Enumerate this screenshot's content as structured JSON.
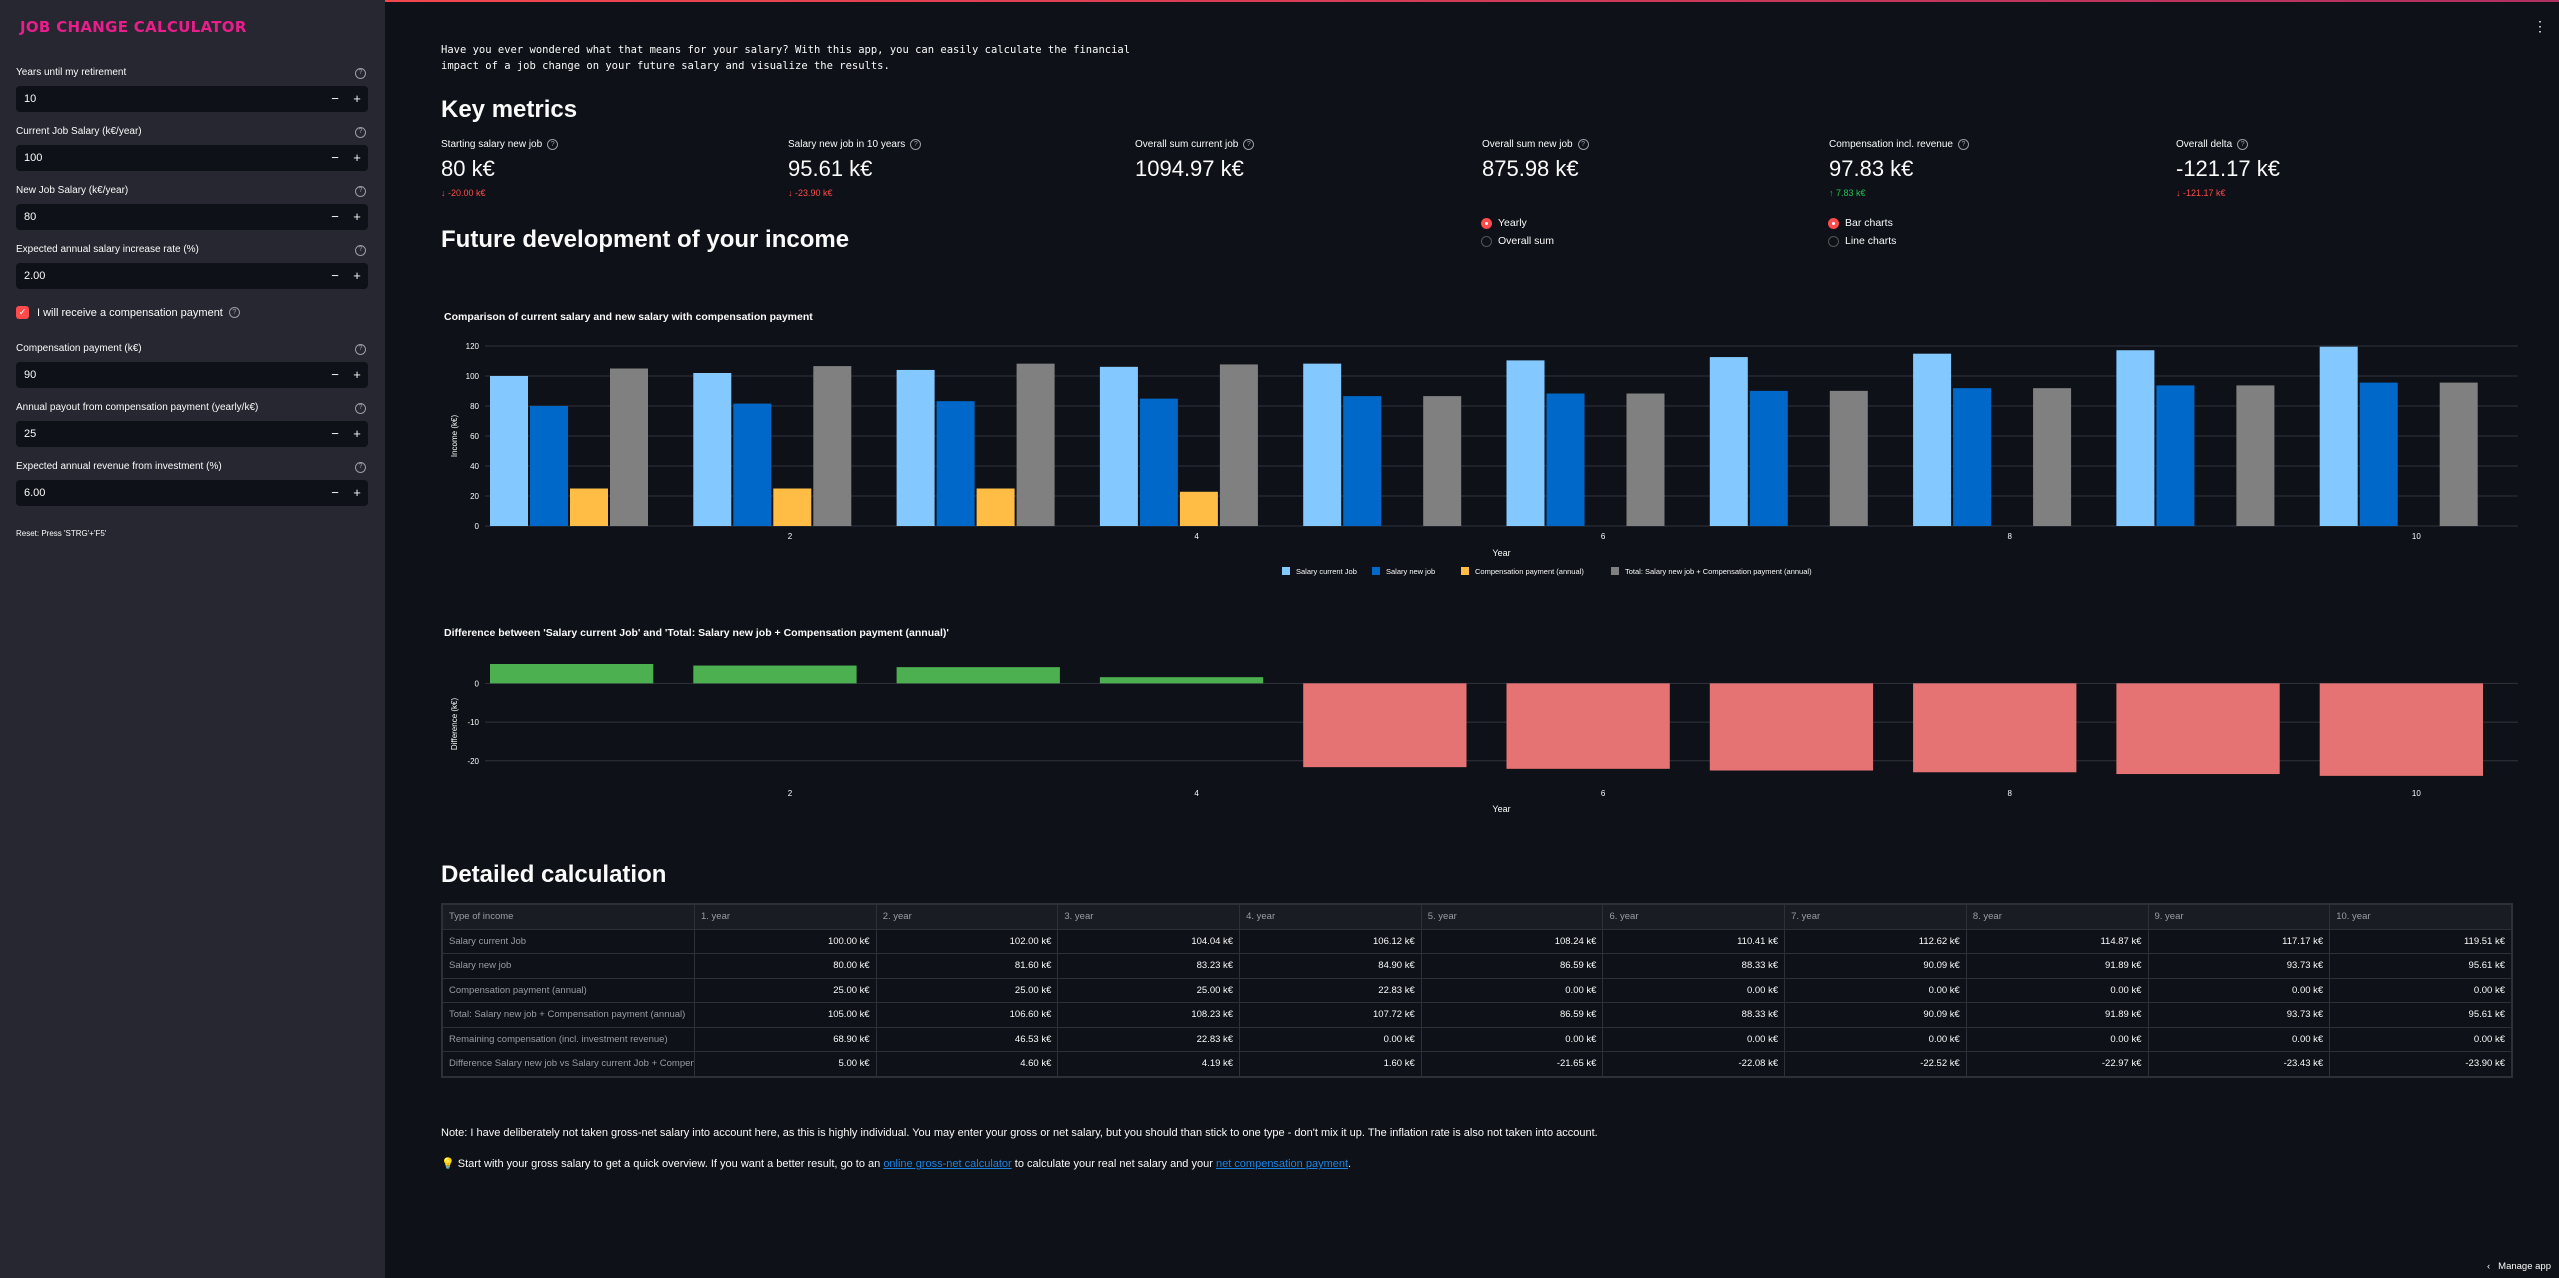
{
  "sidebar": {
    "title": "JOB CHANGE CALCULATOR",
    "fields": [
      {
        "label": "Years until my retirement",
        "value": "10"
      },
      {
        "label": "Current Job Salary (k€/year)",
        "value": "100"
      },
      {
        "label": "New Job Salary (k€/year)",
        "value": "80"
      },
      {
        "label": "Expected annual salary increase rate (%)",
        "value": "2.00"
      }
    ],
    "checkbox_label": "I will receive a compensation payment",
    "fields2": [
      {
        "label": "Compensation payment (k€)",
        "value": "90"
      },
      {
        "label": "Annual payout from compensation payment (yearly/k€)",
        "value": "25"
      },
      {
        "label": "Expected annual revenue from investment (%)",
        "value": "6.00"
      }
    ],
    "minus": "−",
    "plus": "+",
    "help": "?",
    "reset_hint": "Reset: Press 'STRG'+'F5'"
  },
  "intro": "Have you ever wondered what that means for your salary? With this app, you can easily calculate the financial impact of a job change on your future salary and visualize the results.",
  "key_metrics": {
    "heading": "Key metrics",
    "items": [
      {
        "label": "Starting salary new job",
        "value": "80 k€",
        "delta": "-20.00 k€",
        "dir": "down"
      },
      {
        "label": "Salary new job in 10 years",
        "value": "95.61 k€",
        "delta": "-23.90 k€",
        "dir": "down"
      },
      {
        "label": "Overall sum current job",
        "value": "1094.97 k€",
        "delta": "",
        "dir": ""
      },
      {
        "label": "Overall sum new job",
        "value": "875.98 k€",
        "delta": "",
        "dir": ""
      },
      {
        "label": "Compensation incl. revenue",
        "value": "97.83 k€",
        "delta": "7.83 k€",
        "dir": "up"
      },
      {
        "label": "Overall delta",
        "value": "-121.17 k€",
        "delta": "-121.17 k€",
        "dir": "down"
      }
    ]
  },
  "future": {
    "heading": "Future development of your income",
    "radio_period": [
      "Yearly",
      "Overall sum"
    ],
    "radio_period_selected": "Yearly",
    "radio_chart": [
      "Bar charts",
      "Line charts"
    ],
    "radio_chart_selected": "Bar charts"
  },
  "chart_data": [
    {
      "type": "bar",
      "title": "Comparison of current salary and new salary with compensation payment",
      "xlabel": "Year",
      "ylabel": "Income (k€)",
      "ylim": [
        0,
        120
      ],
      "yticks": [
        0,
        20,
        40,
        60,
        80,
        100,
        120
      ],
      "x": [
        1,
        2,
        3,
        4,
        5,
        6,
        7,
        8,
        9,
        10
      ],
      "xticks": [
        2,
        4,
        6,
        8,
        10
      ],
      "grid": true,
      "legend_position": "bottom",
      "series": [
        {
          "name": "Salary current Job",
          "color": "#83c9ff",
          "values": [
            100.0,
            102.0,
            104.04,
            106.12,
            108.24,
            110.41,
            112.62,
            114.87,
            117.17,
            119.51
          ]
        },
        {
          "name": "Salary new job",
          "color": "#0068c9",
          "values": [
            80.0,
            81.6,
            83.23,
            84.9,
            86.59,
            88.33,
            90.09,
            91.89,
            93.73,
            95.61
          ]
        },
        {
          "name": "Compensation payment (annual)",
          "color": "#ffabab",
          "values": [
            25.0,
            25.0,
            25.0,
            22.83,
            0,
            0,
            0,
            0,
            0,
            0
          ]
        },
        {
          "name": "Total: Salary new job + Compensation payment (annual)",
          "color": "#808080",
          "values": [
            105.0,
            106.6,
            108.23,
            107.72,
            86.59,
            88.33,
            90.09,
            91.89,
            93.73,
            95.61
          ]
        }
      ]
    },
    {
      "type": "bar",
      "title": "Difference between 'Salary current Job' and 'Total: Salary new job + Compensation payment (annual)'",
      "xlabel": "Year",
      "ylabel": "Difference (k€)",
      "ylim": [
        -26,
        5
      ],
      "yticks": [
        0,
        -10,
        -20
      ],
      "x": [
        1,
        2,
        3,
        4,
        5,
        6,
        7,
        8,
        9,
        10
      ],
      "xticks": [
        2,
        4,
        6,
        8,
        10
      ],
      "grid": true,
      "positive_color": "#4caf50",
      "negative_color": "#e57373",
      "values": [
        5.0,
        4.6,
        4.19,
        1.6,
        -21.65,
        -22.08,
        -22.52,
        -22.97,
        -23.43,
        -23.9
      ]
    }
  ],
  "detail": {
    "heading": "Detailed calculation",
    "columns": [
      "Type of income",
      "1. year",
      "2. year",
      "3. year",
      "4. year",
      "5. year",
      "6. year",
      "7. year",
      "8. year",
      "9. year",
      "10. year"
    ],
    "rows": [
      [
        "Salary current Job",
        "100.00 k€",
        "102.00 k€",
        "104.04 k€",
        "106.12 k€",
        "108.24 k€",
        "110.41 k€",
        "112.62 k€",
        "114.87 k€",
        "117.17 k€",
        "119.51 k€"
      ],
      [
        "Salary new job",
        "80.00 k€",
        "81.60 k€",
        "83.23 k€",
        "84.90 k€",
        "86.59 k€",
        "88.33 k€",
        "90.09 k€",
        "91.89 k€",
        "93.73 k€",
        "95.61 k€"
      ],
      [
        "Compensation payment (annual)",
        "25.00 k€",
        "25.00 k€",
        "25.00 k€",
        "22.83 k€",
        "0.00 k€",
        "0.00 k€",
        "0.00 k€",
        "0.00 k€",
        "0.00 k€",
        "0.00 k€"
      ],
      [
        "Total: Salary new job + Compensation payment (annual)",
        "105.00 k€",
        "106.60 k€",
        "108.23 k€",
        "107.72 k€",
        "86.59 k€",
        "88.33 k€",
        "90.09 k€",
        "91.89 k€",
        "93.73 k€",
        "95.61 k€"
      ],
      [
        "Remaining compensation (incl. investment revenue)",
        "68.90 k€",
        "46.53 k€",
        "22.83 k€",
        "0.00 k€",
        "0.00 k€",
        "0.00 k€",
        "0.00 k€",
        "0.00 k€",
        "0.00 k€",
        "0.00 k€"
      ],
      [
        "Difference Salary new job vs Salary current Job + Compensa",
        "5.00 k€",
        "4.60 k€",
        "4.19 k€",
        "1.60 k€",
        "-21.65 k€",
        "-22.08 k€",
        "-22.52 k€",
        "-22.97 k€",
        "-23.43 k€",
        "-23.90 k€"
      ]
    ]
  },
  "note": "Note: I have deliberately not taken gross-net salary into account here, as this is highly individual. You may enter your gross or net salary, but you should than stick to one type - don't mix it up. The inflation rate is also not taken into account.",
  "tip": {
    "icon": "💡",
    "before": " Start with your gross salary to get a quick overview. If you want a better result, go to an ",
    "link1": "online gross-net calculator",
    "middle": " to calculate your real net salary and your ",
    "link2": "net compensation payment",
    "after": "."
  },
  "manage": {
    "chevron": "‹",
    "label": "Manage app"
  },
  "menu": "⋮"
}
